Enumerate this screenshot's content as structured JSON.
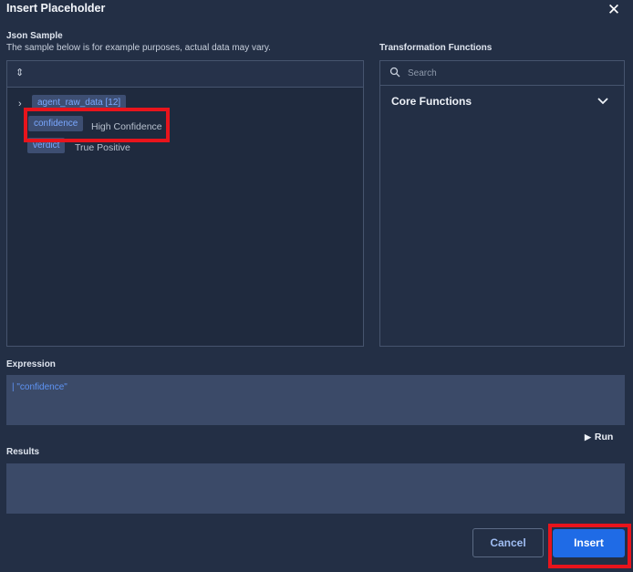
{
  "dialog": {
    "title": "Insert Placeholder",
    "close_icon": "close-icon"
  },
  "json_sample": {
    "label": "Json Sample",
    "description": "The sample below is for example purposes, actual data may vary.",
    "sort_icon": "sort-icon",
    "tree": [
      {
        "key": "agent_raw_data [12]",
        "value": "",
        "expandable": true
      },
      {
        "key": "confidence",
        "value": "High Confidence",
        "expandable": false
      },
      {
        "key": "verdict",
        "value": "True Positive",
        "expandable": false
      }
    ]
  },
  "transformation": {
    "label": "Transformation Functions",
    "search_placeholder": "Search",
    "core_functions_label": "Core Functions"
  },
  "expression": {
    "label": "Expression",
    "value": "| \"confidence\""
  },
  "run": {
    "label": "Run"
  },
  "results": {
    "label": "Results",
    "value": ""
  },
  "buttons": {
    "cancel": "Cancel",
    "insert": "Insert"
  },
  "colors": {
    "background": "#232f45",
    "accent": "#1f6be6",
    "highlight": "#e8141c",
    "chip_bg": "#3d4e72",
    "chip_text": "#7aa8ff"
  }
}
